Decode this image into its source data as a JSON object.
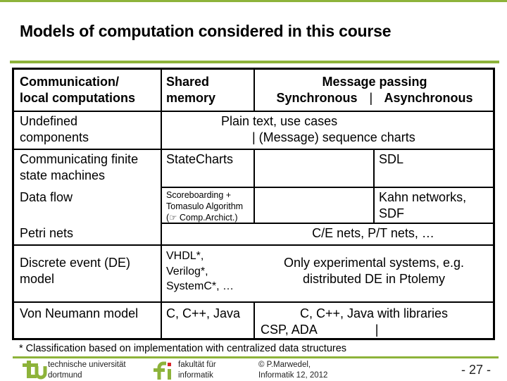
{
  "slide": {
    "title": "Models of computation considered in this course",
    "header": {
      "col1": [
        "Communication/",
        "local computations"
      ],
      "col2": [
        "Shared",
        "memory"
      ],
      "col3_title": "Message passing",
      "col3_sync": "Synchronous",
      "col3_sep": "|",
      "col3_async": "Asynchronous"
    },
    "rows": {
      "undefined": {
        "label": [
          "Undefined",
          "components"
        ],
        "line1": "Plain text, use cases",
        "line2": "|   (Message) sequence charts"
      },
      "cfsm": {
        "label": [
          "Communicating finite",
          "state machines"
        ],
        "shared": "StateCharts",
        "async": "SDL"
      },
      "dataflow": {
        "label": "Data flow",
        "shared": [
          "Scoreboarding +",
          "Tomasulo Algorithm",
          "(☞ Comp.Archict.)"
        ],
        "async": [
          "Kahn networks,",
          "SDF"
        ]
      },
      "petri": {
        "label": "Petri nets",
        "content": "C/E nets, P/T nets, …"
      },
      "de": {
        "label": [
          "Discrete event (DE)",
          "model"
        ],
        "shared": [
          "VHDL*,",
          "Verilog*,",
          "SystemC*, …"
        ],
        "msg": [
          "Only experimental systems, e.g.",
          "distributed DE in Ptolemy"
        ]
      },
      "vn": {
        "label": "Von Neumann model",
        "shared": "C, C++, Java",
        "msg_line1": "C, C++, Java with libraries",
        "msg_line2_left": "CSP, ADA",
        "msg_line2_sep": "|"
      }
    },
    "footnote": "* Classification based on implementation with centralized data structures",
    "footer": {
      "tu_logo": "tu",
      "tu_text": [
        "technische universität",
        "dortmund"
      ],
      "fi_logo": "fi",
      "fi_text": [
        "fakultät für",
        "informatik"
      ],
      "copyright": [
        "© P.Marwedel,",
        "Informatik 12,  2012"
      ],
      "page": "-  27 -"
    },
    "colors": {
      "accent_green": "#8db33a",
      "logo_red": "#d9262b"
    }
  }
}
